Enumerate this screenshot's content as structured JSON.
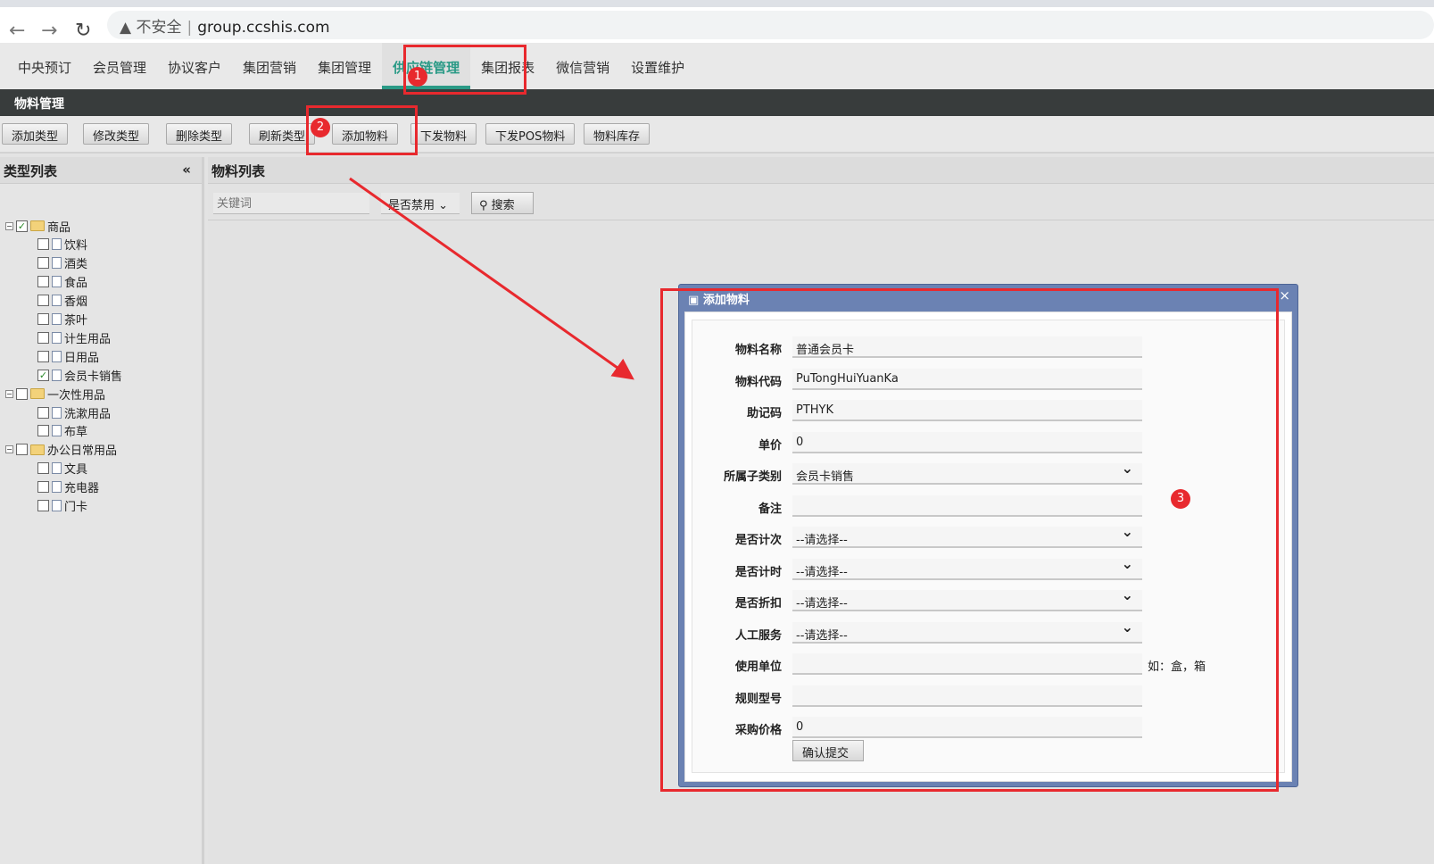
{
  "browser": {
    "security": "不安全",
    "url": "group.ccshis.com"
  },
  "nav": [
    "中央预订",
    "会员管理",
    "协议客户",
    "集团营销",
    "集团管理",
    "供应链管理",
    "集团报表",
    "微信营销",
    "设置维护"
  ],
  "section_title": "物料管理",
  "toolbar": [
    "添加类型",
    "修改类型",
    "删除类型",
    "刷新类型",
    "添加物料",
    "下发物料",
    "下发POS物料",
    "物料库存"
  ],
  "left": {
    "title": "类型列表",
    "collapse": "«",
    "tree": [
      {
        "label": "商品",
        "level": 0,
        "checked": true,
        "folder": true
      },
      {
        "label": "饮料",
        "level": 1,
        "checked": false
      },
      {
        "label": "酒类",
        "level": 1,
        "checked": false
      },
      {
        "label": "食品",
        "level": 1,
        "checked": false
      },
      {
        "label": "香烟",
        "level": 1,
        "checked": false
      },
      {
        "label": "茶叶",
        "level": 1,
        "checked": false
      },
      {
        "label": "计生用品",
        "level": 1,
        "checked": false
      },
      {
        "label": "日用品",
        "level": 1,
        "checked": false
      },
      {
        "label": "会员卡销售",
        "level": 1,
        "checked": true
      },
      {
        "label": "一次性用品",
        "level": 0,
        "checked": false,
        "folder": true
      },
      {
        "label": "洗漱用品",
        "level": 1,
        "checked": false
      },
      {
        "label": "布草",
        "level": 1,
        "checked": false
      },
      {
        "label": "办公日常用品",
        "level": 0,
        "checked": false,
        "folder": true
      },
      {
        "label": "文具",
        "level": 1,
        "checked": false
      },
      {
        "label": "充电器",
        "level": 1,
        "checked": false
      },
      {
        "label": "门卡",
        "level": 1,
        "checked": false
      }
    ]
  },
  "right": {
    "title": "物料列表",
    "keyword_placeholder": "关键词",
    "disabled_select": "是否禁用",
    "search": "搜索"
  },
  "dialog": {
    "title": "添加物料",
    "close": "×",
    "fields": [
      {
        "label": "物料名称",
        "value": "普通会员卡"
      },
      {
        "label": "物料代码",
        "value": "PuTongHuiYuanKa"
      },
      {
        "label": "助记码",
        "value": "PTHYK"
      },
      {
        "label": "单价",
        "value": "0"
      },
      {
        "label": "所属子类别",
        "value": "会员卡销售",
        "select": true
      },
      {
        "label": "备注",
        "value": ""
      },
      {
        "label": "是否计次",
        "value": "--请选择--",
        "select": true
      },
      {
        "label": "是否计时",
        "value": "--请选择--",
        "select": true
      },
      {
        "label": "是否折扣",
        "value": "--请选择--",
        "select": true
      },
      {
        "label": "人工服务",
        "value": "--请选择--",
        "select": true
      },
      {
        "label": "使用单位",
        "value": "",
        "hint": "如：盒，箱"
      },
      {
        "label": "规则型号",
        "value": ""
      },
      {
        "label": "采购价格",
        "value": "0"
      }
    ],
    "submit": "确认提交"
  },
  "annotations": [
    "1",
    "2",
    "3"
  ],
  "colors": {
    "accent": "#2a9a86",
    "annotation": "#e8292e",
    "dialog": "#6b82b3"
  }
}
